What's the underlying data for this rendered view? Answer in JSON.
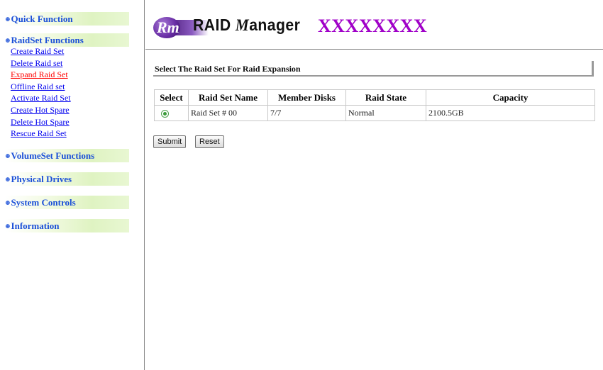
{
  "sidebar": {
    "bullet": "⊕",
    "quick_function": "Quick Function",
    "raidset_functions": "RaidSet Functions",
    "raidset_items": [
      "Create Raid Set",
      "Delete Raid set",
      "Expand Raid Set",
      "Offline Raid set",
      "Activate Raid Set",
      "Create Hot Spare",
      "Delete Hot Spare",
      "Rescue Raid Set"
    ],
    "active_item": "Expand Raid Set",
    "volumeset_functions": "VolumeSet Functions",
    "physical_drives": "Physical Drives",
    "system_controls": "System Controls",
    "information": "Information"
  },
  "header": {
    "logo_badge": "Rm",
    "logo_text_prefix": "RAID ",
    "logo_text_m": "M",
    "logo_text_suffix": "anager",
    "model_name": "XXXXXXXX"
  },
  "main": {
    "heading": "Select The Raid Set For Raid Expansion",
    "columns": [
      "Select",
      "Raid Set Name",
      "Member Disks",
      "Raid State",
      "Capacity"
    ],
    "rows": [
      {
        "name": "Raid Set # 00",
        "member_disks": "7/7",
        "state": "Normal",
        "capacity": "2100.5GB",
        "selected": true
      }
    ],
    "submit_label": "Submit",
    "reset_label": "Reset"
  },
  "colors": {
    "link": "#0000ee",
    "active_link": "#ff0000",
    "section_head": "#1a4fd8",
    "model_name": "#a000c8"
  }
}
